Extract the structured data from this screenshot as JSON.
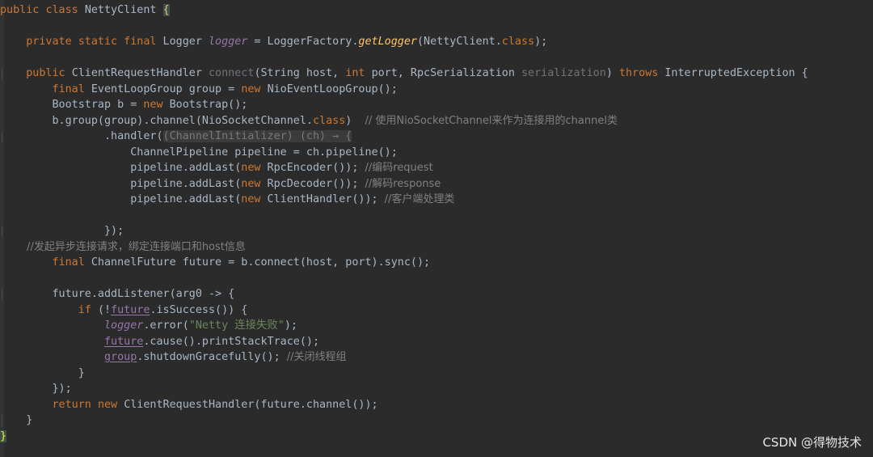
{
  "editor": {
    "lines": [
      [
        {
          "t": "public ",
          "c": "kw"
        },
        {
          "t": "class ",
          "c": "kw"
        },
        {
          "t": "NettyClient ",
          "c": "cls"
        },
        {
          "t": "{",
          "c": "brace"
        }
      ],
      [],
      [
        {
          "t": "    private static final ",
          "c": "kw"
        },
        {
          "t": "Logger ",
          "c": "cls"
        },
        {
          "t": "logger",
          "c": "field"
        },
        {
          "t": " = LoggerFactory.",
          "c": "plain"
        },
        {
          "t": "getLogger",
          "c": "static"
        },
        {
          "t": "(NettyClient.",
          "c": "plain"
        },
        {
          "t": "class",
          "c": "kw"
        },
        {
          "t": ");",
          "c": "plain"
        }
      ],
      [],
      [
        {
          "t": "    public ",
          "c": "kw"
        },
        {
          "t": "ClientRequestHandler ",
          "c": "cls"
        },
        {
          "t": "connect",
          "c": "unused"
        },
        {
          "t": "(String host, ",
          "c": "plain"
        },
        {
          "t": "int ",
          "c": "kw"
        },
        {
          "t": "port, RpcSerialization ",
          "c": "plain"
        },
        {
          "t": "serialization",
          "c": "unused"
        },
        {
          "t": ") ",
          "c": "plain"
        },
        {
          "t": "throws ",
          "c": "kw"
        },
        {
          "t": "InterruptedException {",
          "c": "plain"
        }
      ],
      [
        {
          "t": "        final ",
          "c": "kw"
        },
        {
          "t": "EventLoopGroup group = ",
          "c": "plain"
        },
        {
          "t": "new ",
          "c": "kw"
        },
        {
          "t": "NioEventLoopGroup();",
          "c": "plain"
        }
      ],
      [
        {
          "t": "        Bootstrap b = ",
          "c": "plain"
        },
        {
          "t": "new ",
          "c": "kw"
        },
        {
          "t": "Bootstrap();",
          "c": "plain"
        }
      ],
      [
        {
          "t": "        b.group(group).channel(NioSocketChannel.",
          "c": "plain"
        },
        {
          "t": "class",
          "c": "kw"
        },
        {
          "t": ")  ",
          "c": "plain"
        },
        {
          "t": "// 使用NioSocketChannel来作为连接用的channel类",
          "c": "comment"
        }
      ],
      [
        {
          "t": "                .handler(",
          "c": "plain"
        },
        {
          "t": "(ChannelInitializer) (ch) → {",
          "c": "hint"
        }
      ],
      [
        {
          "t": "                    ChannelPipeline pipeline = ch.pipeline();",
          "c": "plain"
        }
      ],
      [
        {
          "t": "                    pipeline.addLast(",
          "c": "plain"
        },
        {
          "t": "new ",
          "c": "kw"
        },
        {
          "t": "RpcEncoder()); ",
          "c": "plain"
        },
        {
          "t": "//编码request",
          "c": "comment"
        }
      ],
      [
        {
          "t": "                    pipeline.addLast(",
          "c": "plain"
        },
        {
          "t": "new ",
          "c": "kw"
        },
        {
          "t": "RpcDecoder()); ",
          "c": "plain"
        },
        {
          "t": "//解码response",
          "c": "comment"
        }
      ],
      [
        {
          "t": "                    pipeline.addLast(",
          "c": "plain"
        },
        {
          "t": "new ",
          "c": "kw"
        },
        {
          "t": "ClientHandler()); ",
          "c": "plain"
        },
        {
          "t": "//客户端处理类",
          "c": "comment"
        }
      ],
      [],
      [
        {
          "t": "                });",
          "c": "plain"
        }
      ],
      [
        {
          "t": "        //发起异步连接请求，绑定连接端口和host信息",
          "c": "comment"
        }
      ],
      [
        {
          "t": "        final ",
          "c": "kw"
        },
        {
          "t": "ChannelFuture future = b.connect(host, port).sync();",
          "c": "plain"
        }
      ],
      [],
      [
        {
          "t": "        future.addListener(arg0 -> {",
          "c": "plain"
        }
      ],
      [
        {
          "t": "            if ",
          "c": "kw"
        },
        {
          "t": "(!",
          "c": "plain"
        },
        {
          "t": "future",
          "c": "ul"
        },
        {
          "t": ".isSuccess()) {",
          "c": "plain"
        }
      ],
      [
        {
          "t": "                ",
          "c": "plain"
        },
        {
          "t": "logger",
          "c": "field"
        },
        {
          "t": ".error(",
          "c": "plain"
        },
        {
          "t": "\"Netty 连接失败\"",
          "c": "string"
        },
        {
          "t": ");",
          "c": "plain"
        }
      ],
      [
        {
          "t": "                ",
          "c": "plain"
        },
        {
          "t": "future",
          "c": "ul"
        },
        {
          "t": ".cause().printStackTrace();",
          "c": "plain"
        }
      ],
      [
        {
          "t": "                ",
          "c": "plain"
        },
        {
          "t": "group",
          "c": "ul"
        },
        {
          "t": ".shutdownGracefully(); ",
          "c": "plain"
        },
        {
          "t": "//关闭线程组",
          "c": "comment"
        }
      ],
      [
        {
          "t": "            }",
          "c": "plain"
        }
      ],
      [
        {
          "t": "        });",
          "c": "plain"
        }
      ],
      [
        {
          "t": "        return ",
          "c": "kw"
        },
        {
          "t": "new ",
          "c": "kw"
        },
        {
          "t": "ClientRequestHandler(future.channel());",
          "c": "plain"
        }
      ],
      [
        {
          "t": "    }",
          "c": "plain"
        }
      ],
      [
        {
          "t": "}",
          "c": "bracehl"
        }
      ]
    ]
  },
  "watermark": "CSDN @得物技术"
}
